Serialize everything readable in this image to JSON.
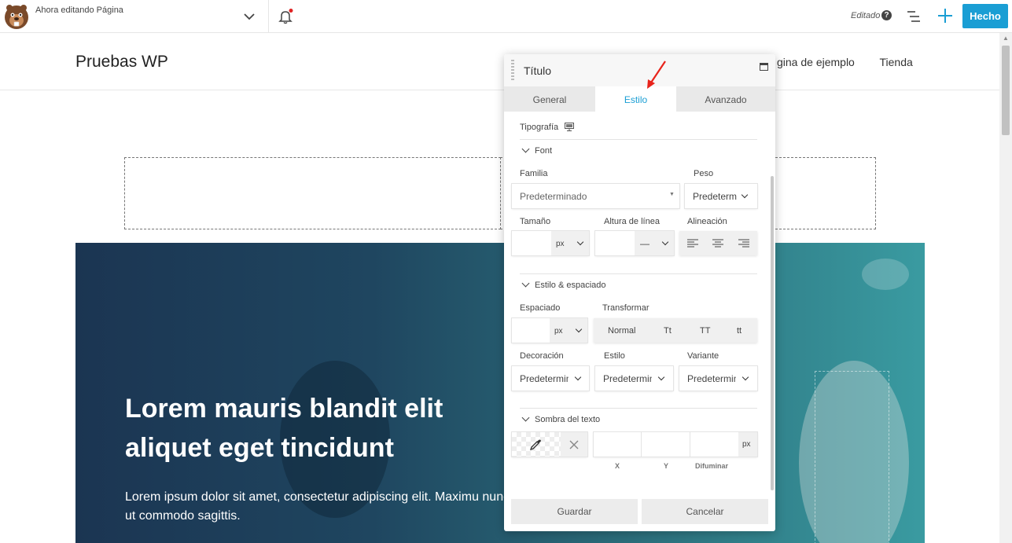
{
  "topbar": {
    "editing_label": "Ahora editando Página",
    "status": "Editado",
    "help": "?",
    "done_label": "Hecho"
  },
  "site": {
    "title": "Pruebas WP",
    "nav": [
      "gina de ejemplo",
      "Tienda"
    ]
  },
  "hero": {
    "heading": "Lorem mauris blandit elit aliquet eget tincidunt",
    "text": "Lorem ipsum dolor sit amet, consectetur adipiscing elit. Maximu nunc nulla ut commodo sagittis."
  },
  "panel": {
    "title": "Título",
    "tabs": [
      "General",
      "Estilo",
      "Avanzado"
    ],
    "active_tab": "Estilo",
    "typography_label": "Tipografía",
    "font_section": "Font",
    "family_label": "Familia",
    "family_value": "Predeterminado",
    "weight_label": "Peso",
    "weight_value": "Predeterm",
    "size_label": "Tamaño",
    "size_unit": "px",
    "lineheight_label": "Altura de línea",
    "lineheight_unit": "—",
    "align_label": "Alineación",
    "style_section": "Estilo & espaciado",
    "spacing_label": "Espaciado",
    "spacing_unit": "px",
    "transform_label": "Transformar",
    "transform_options": [
      "Normal",
      "Tt",
      "TT",
      "tt"
    ],
    "decoration_label": "Decoración",
    "decoration_value": "Predetermin",
    "style_label": "Estilo",
    "style_value": "Predetermin",
    "variant_label": "Variante",
    "variant_value": "Predetermin",
    "shadow_section": "Sombra del texto",
    "shadow_unit": "px",
    "shadow_labels": [
      "X",
      "Y",
      "Difuminar"
    ],
    "save_label": "Guardar",
    "cancel_label": "Cancelar"
  },
  "colors": {
    "accent": "#1a9ed4",
    "hero_dark": "#1b3552",
    "hero_light": "#3a9ba1",
    "annotation_arrow": "#e8231b"
  }
}
